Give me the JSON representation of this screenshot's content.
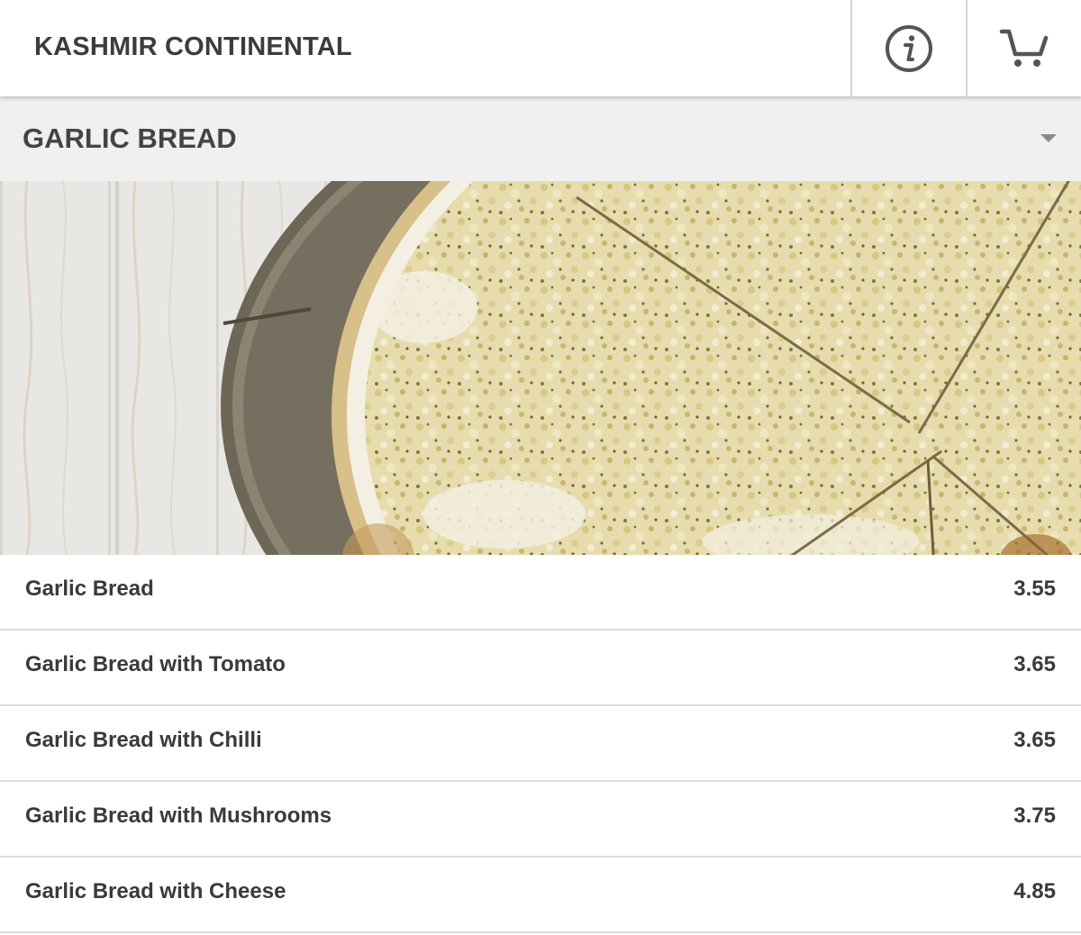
{
  "header": {
    "title": "KASHMIR CONTINENTAL",
    "info_icon": "info-icon",
    "cart_icon": "cart-icon"
  },
  "category": {
    "title": "GARLIC BREAD",
    "toggle_icon": "caret-down-icon"
  },
  "hero": {
    "image": "garlic-bread-pizza-photo"
  },
  "menu": {
    "items": [
      {
        "name": "Garlic Bread",
        "price": "3.55"
      },
      {
        "name": "Garlic Bread with Tomato",
        "price": "3.65"
      },
      {
        "name": "Garlic Bread with Chilli",
        "price": "3.65"
      },
      {
        "name": "Garlic Bread with Mushrooms",
        "price": "3.75"
      },
      {
        "name": "Garlic Bread with Cheese",
        "price": "4.85"
      }
    ]
  },
  "colors": {
    "header_bg": "#ffffff",
    "category_bg": "#f0f0f0",
    "text": "#3a3a3a",
    "divider": "#dcdcdc",
    "icon": "#555555"
  }
}
